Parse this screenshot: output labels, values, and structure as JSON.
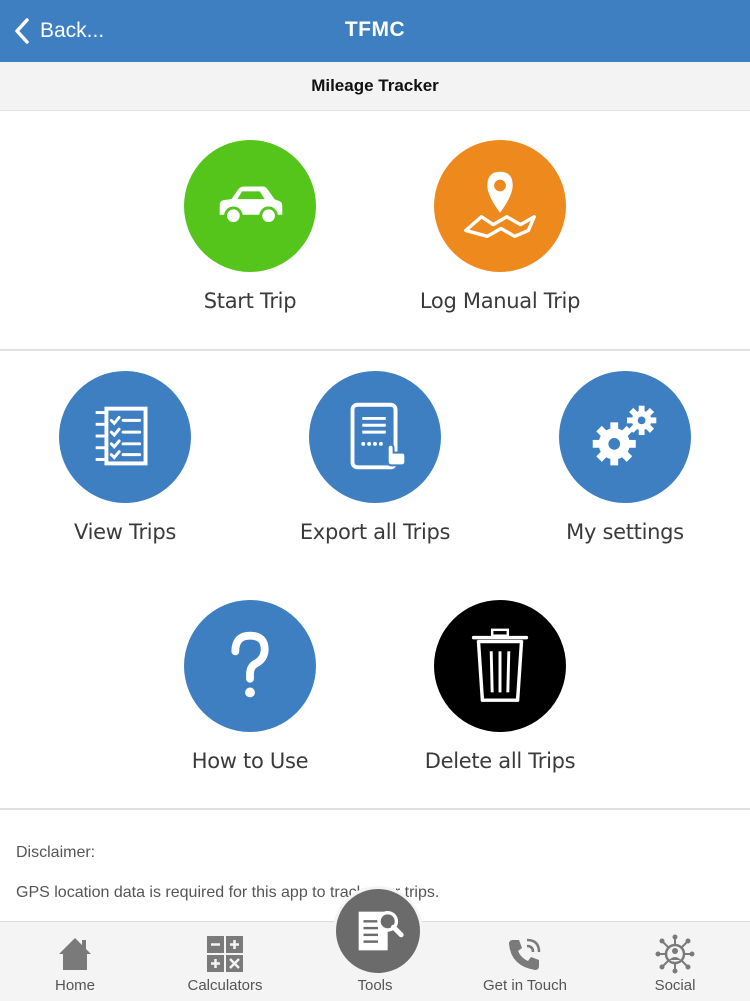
{
  "navbar": {
    "back_label": "Back...",
    "title": "TFMC",
    "back_icon": "chevron-left-icon"
  },
  "subheader": {
    "title": "Mileage Tracker"
  },
  "tiles": {
    "start_trip": {
      "label": "Start Trip",
      "icon": "car-icon",
      "color": "#55c41b"
    },
    "log_manual_trip": {
      "label": "Log Manual Trip",
      "icon": "map-pin-icon",
      "color": "#ee8a1d"
    },
    "view_trips": {
      "label": "View Trips",
      "icon": "checklist-icon",
      "color": "#3d7fc1"
    },
    "export_all_trips": {
      "label": "Export all Trips",
      "icon": "tablet-tap-icon",
      "color": "#3d7fc1"
    },
    "my_settings": {
      "label": "My settings",
      "icon": "gears-icon",
      "color": "#3d7fc1"
    },
    "how_to_use": {
      "label": "How to Use",
      "icon": "question-icon",
      "color": "#3d7fc1"
    },
    "delete_all_trips": {
      "label": "Delete all Trips",
      "icon": "trash-icon",
      "color": "#000000"
    }
  },
  "disclaimer": {
    "heading": "Disclaimer:",
    "text": "GPS location data is required for this app to track your trips."
  },
  "tabbar": {
    "tabs": [
      {
        "label": "Home",
        "icon": "house-icon"
      },
      {
        "label": "Calculators",
        "icon": "calculator-icon"
      },
      {
        "label": "Tools",
        "icon": "document-search-icon"
      },
      {
        "label": "Get in Touch",
        "icon": "phone-icon"
      },
      {
        "label": "Social",
        "icon": "people-network-icon"
      }
    ]
  }
}
